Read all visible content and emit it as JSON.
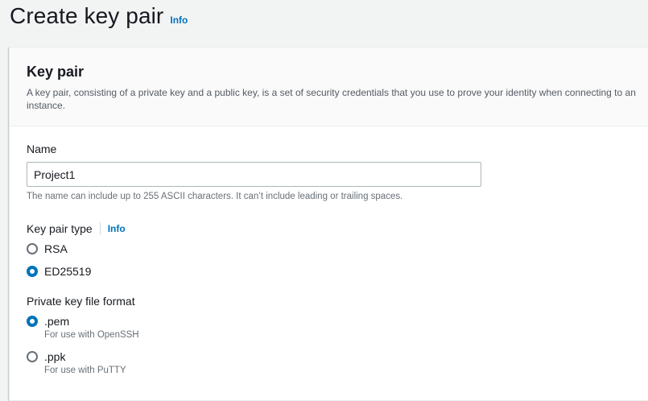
{
  "header": {
    "title": "Create key pair",
    "info": "Info"
  },
  "panel": {
    "title": "Key pair",
    "description": "A key pair, consisting of a private key and a public key, is a set of security credentials that you use to prove your identity when connecting to an instance."
  },
  "name_field": {
    "label": "Name",
    "value": "Project1",
    "hint": "The name can include up to 255 ASCII characters. It can’t include leading or trailing spaces."
  },
  "key_type": {
    "label": "Key pair type",
    "info": "Info",
    "options": [
      {
        "label": "RSA",
        "checked": false
      },
      {
        "label": "ED25519",
        "checked": true
      }
    ]
  },
  "file_format": {
    "label": "Private key file format",
    "options": [
      {
        "label": ".pem",
        "description": "For use with OpenSSH",
        "checked": true
      },
      {
        "label": ".ppk",
        "description": "For use with PuTTY",
        "checked": false
      }
    ]
  },
  "colors": {
    "accent": "#0073bb",
    "background": "#f2f3f3",
    "text": "#16191f",
    "muted": "#687078"
  }
}
